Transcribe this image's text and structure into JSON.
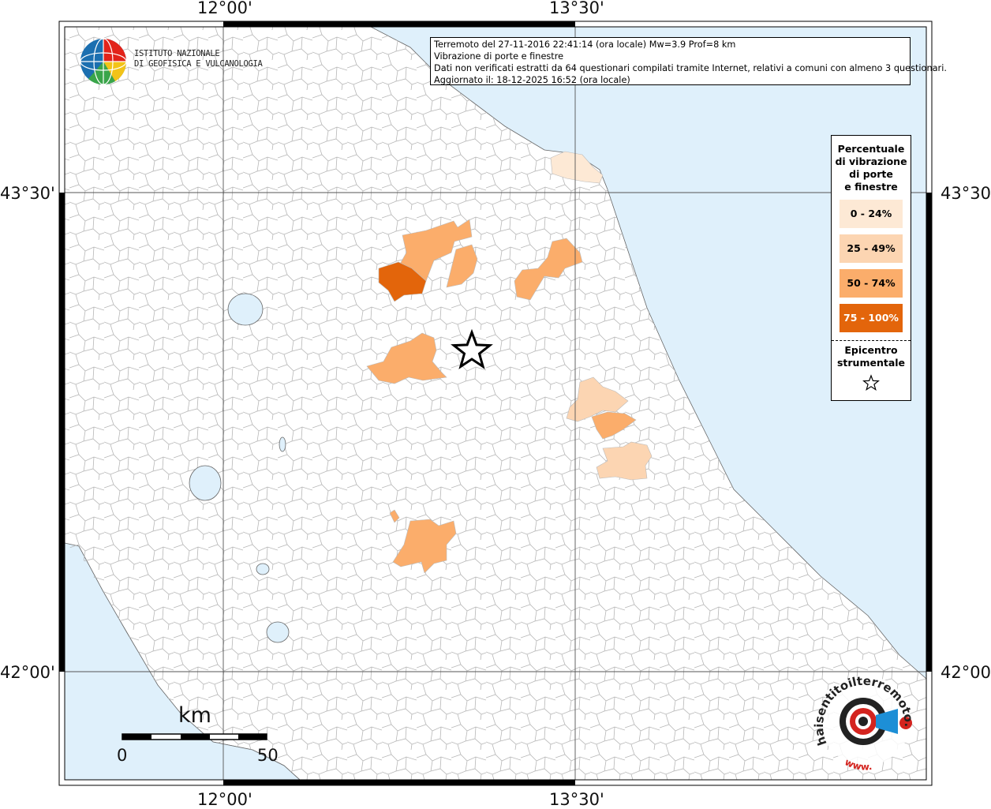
{
  "map": {
    "coords": {
      "top_left": "12°00'",
      "top_right": "13°30'",
      "bottom_left": "12°00'",
      "bottom_right": "13°30'",
      "left_upper": "43°30'",
      "left_lower": "42°00'",
      "right_upper": "43°30'",
      "right_lower": "42°00'"
    },
    "info": {
      "line1": "Terremoto del 27-11-2016 22:41:14 (ora locale) Mw=3.9 Prof=8 km",
      "line2": "Vibrazione di porte e finestre",
      "line3": "Dati non verificati estratti da 64 questionari compilati tramite Internet, relativi a comuni con almeno 3 questionari.",
      "line4": "Aggiornato il: 18-12-2025 16:52 (ora locale)"
    },
    "logo": {
      "line1": "ISTITUTO NAZIONALE",
      "line2": "DI GEOFISICA E VULCANOLOGIA"
    },
    "legend": {
      "title": [
        "Percentuale",
        "di vibrazione",
        "di porte",
        "e finestre"
      ],
      "classes": [
        {
          "label": "0 - 24%",
          "color": "#fde9d5"
        },
        {
          "label": "25 - 49%",
          "color": "#fcd5b2"
        },
        {
          "label": "50 - 74%",
          "color": "#fbad6b"
        },
        {
          "label": "75 - 100%",
          "color": "#e3650b"
        }
      ],
      "epicenter": [
        "Epicentro",
        "strumentale"
      ]
    },
    "scale": {
      "unit": "km",
      "start": "0",
      "end": "50"
    },
    "watermark": {
      "text_main": "haisentitoilterremoto.it",
      "text_url": "www."
    },
    "colors": {
      "sea": "#dff0fb",
      "land": "#ffffff",
      "border": "#aaaaaa",
      "class_0_24": "#fde9d5",
      "class_25_49": "#fcd5b2",
      "class_50_74": "#fbad6b",
      "class_75_100": "#e3650b"
    }
  }
}
